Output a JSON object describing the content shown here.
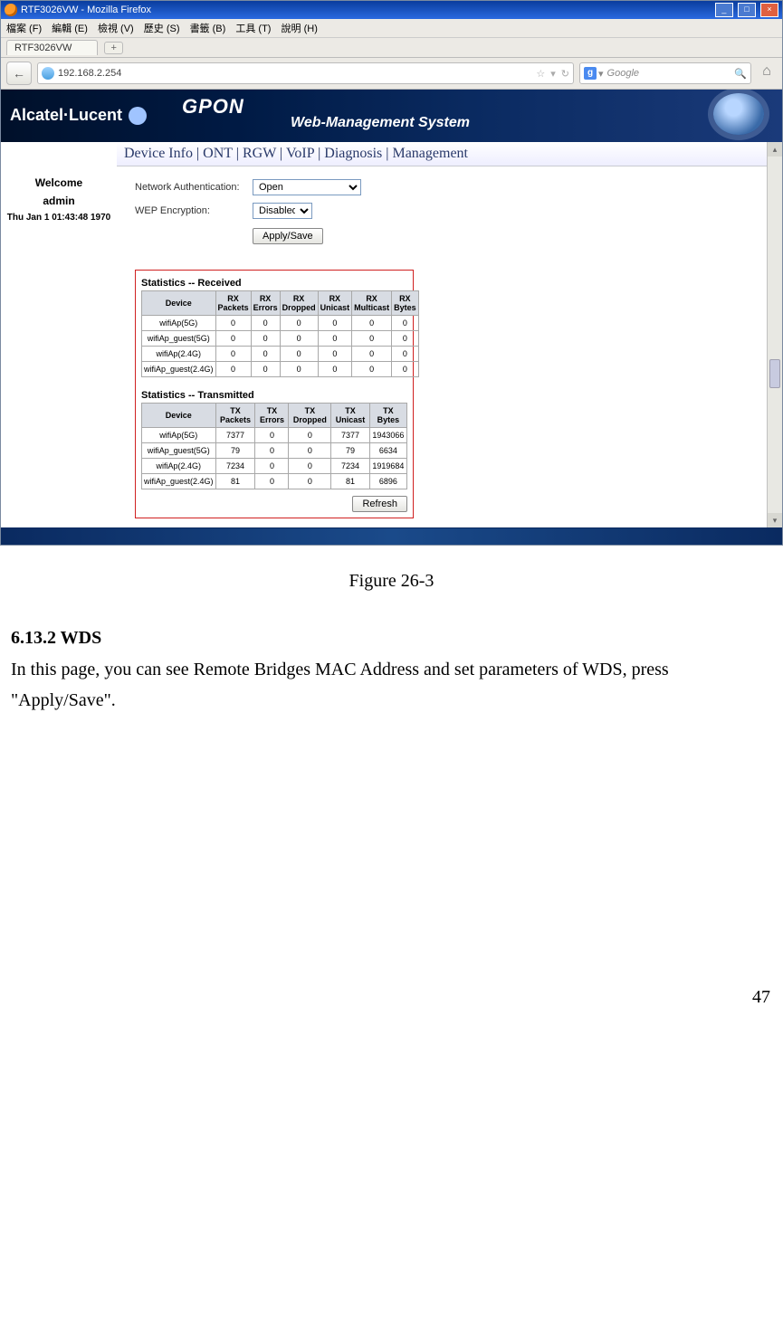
{
  "window": {
    "title": "RTF3026VW - Mozilla Firefox",
    "menus": [
      "檔案 (F)",
      "編輯 (E)",
      "檢視 (V)",
      "歷史 (S)",
      "書籤 (B)",
      "工具 (T)",
      "說明 (H)"
    ],
    "tab": "RTF3026VW",
    "url": "192.168.2.254",
    "search_placeholder": "Google"
  },
  "banner": {
    "brand": "Alcatel·Lucent",
    "title1": "GPON",
    "title2": "Web-Management System"
  },
  "crumbs": [
    "Device Info",
    "ONT",
    "RGW",
    "VoIP",
    "Diagnosis",
    "Management"
  ],
  "sidebar": {
    "welcome": "Welcome",
    "user": "admin",
    "timestamp": "Thu Jan 1 01:43:48 1970"
  },
  "form": {
    "auth_label": "Network Authentication:",
    "auth_value": "Open",
    "wep_label": "WEP Encryption:",
    "wep_value": "Disabled",
    "apply": "Apply/Save"
  },
  "stats": {
    "rx_title": "Statistics -- Received",
    "rx_headers": [
      "Device",
      "RX Packets",
      "RX Errors",
      "RX Dropped",
      "RX Unicast",
      "RX Multicast",
      "RX Bytes"
    ],
    "rx_rows": [
      {
        "d": "wifiAp(5G)",
        "v": [
          "0",
          "0",
          "0",
          "0",
          "0",
          "0"
        ]
      },
      {
        "d": "wifiAp_guest(5G)",
        "v": [
          "0",
          "0",
          "0",
          "0",
          "0",
          "0"
        ]
      },
      {
        "d": "wifiAp(2.4G)",
        "v": [
          "0",
          "0",
          "0",
          "0",
          "0",
          "0"
        ]
      },
      {
        "d": "wifiAp_guest(2.4G)",
        "v": [
          "0",
          "0",
          "0",
          "0",
          "0",
          "0"
        ]
      }
    ],
    "tx_title": "Statistics -- Transmitted",
    "tx_headers": [
      "Device",
      "TX Packets",
      "TX Errors",
      "TX Dropped",
      "TX Unicast",
      "TX Bytes"
    ],
    "tx_rows": [
      {
        "d": "wifiAp(5G)",
        "v": [
          "7377",
          "0",
          "0",
          "7377",
          "1943066"
        ]
      },
      {
        "d": "wifiAp_guest(5G)",
        "v": [
          "79",
          "0",
          "0",
          "79",
          "6634"
        ]
      },
      {
        "d": "wifiAp(2.4G)",
        "v": [
          "7234",
          "0",
          "0",
          "7234",
          "1919684"
        ]
      },
      {
        "d": "wifiAp_guest(2.4G)",
        "v": [
          "81",
          "0",
          "0",
          "81",
          "6896"
        ]
      }
    ],
    "refresh": "Refresh"
  },
  "caption": "Figure 26-3",
  "doc": {
    "heading": "6.13.2  WDS",
    "body": "In this page, you can see Remote Bridges MAC Address and set parameters of WDS, press \"Apply/Save\"."
  },
  "page_number": "47"
}
